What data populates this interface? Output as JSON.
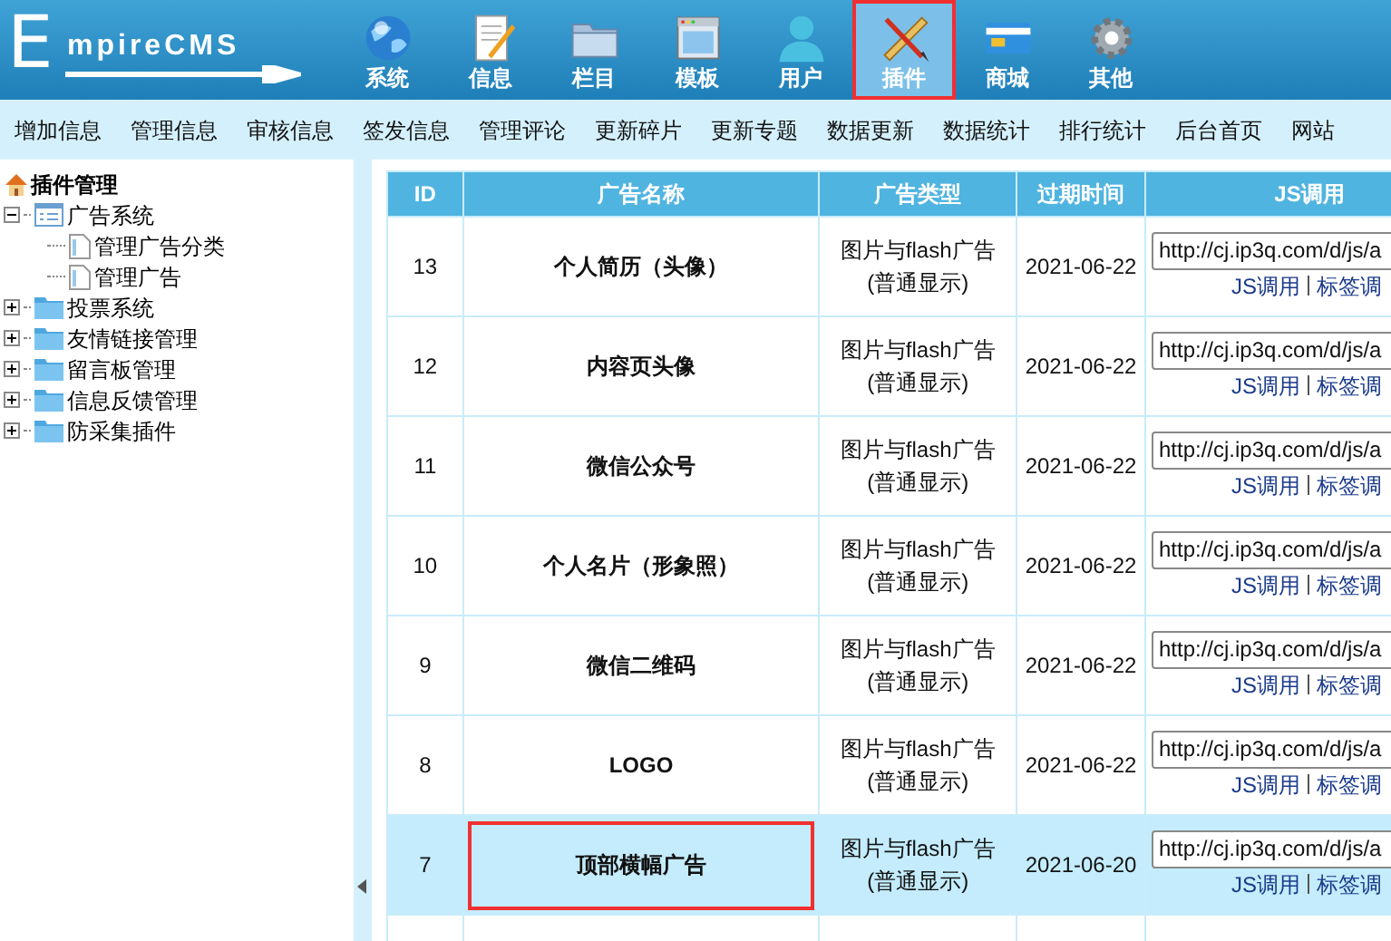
{
  "logo": {
    "text": "mpireCMS",
    "initial": "E"
  },
  "nav": [
    {
      "label": "系统",
      "selected": false,
      "outlined": false
    },
    {
      "label": "信息",
      "selected": false,
      "outlined": false
    },
    {
      "label": "栏目",
      "selected": false,
      "outlined": false
    },
    {
      "label": "模板",
      "selected": false,
      "outlined": false
    },
    {
      "label": "用户",
      "selected": false,
      "outlined": false
    },
    {
      "label": "插件",
      "selected": true,
      "outlined": true
    },
    {
      "label": "商城",
      "selected": false,
      "outlined": false
    },
    {
      "label": "其他",
      "selected": false,
      "outlined": false
    }
  ],
  "menu": [
    "增加信息",
    "管理信息",
    "审核信息",
    "签发信息",
    "管理评论",
    "更新碎片",
    "更新专题",
    "数据更新",
    "数据统计",
    "排行统计",
    "后台首页",
    "网站"
  ],
  "sidebar": {
    "title": "插件管理",
    "items": [
      {
        "label": "广告系统",
        "expanded": true,
        "children": [
          {
            "label": "管理广告分类"
          },
          {
            "label": "管理广告"
          }
        ]
      },
      {
        "label": "投票系统",
        "expanded": false
      },
      {
        "label": "友情链接管理",
        "expanded": false
      },
      {
        "label": "留言板管理",
        "expanded": false
      },
      {
        "label": "信息反馈管理",
        "expanded": false
      },
      {
        "label": "防采集插件",
        "expanded": false
      }
    ]
  },
  "table": {
    "columns": [
      "ID",
      "广告名称",
      "广告类型",
      "过期时间",
      "JS调用"
    ],
    "rows": [
      {
        "id": "13",
        "name": "个人简历（头像）",
        "type": "图片与flash广告",
        "mode": "(普通显示)",
        "expires": "2021-06-22",
        "js": "http://cj.ip3q.com/d/js/a",
        "links": [
          "JS调用",
          "标签调"
        ],
        "selected": false,
        "outlined": false
      },
      {
        "id": "12",
        "name": "内容页头像",
        "type": "图片与flash广告",
        "mode": "(普通显示)",
        "expires": "2021-06-22",
        "js": "http://cj.ip3q.com/d/js/a",
        "links": [
          "JS调用",
          "标签调"
        ],
        "selected": false,
        "outlined": false
      },
      {
        "id": "11",
        "name": "微信公众号",
        "type": "图片与flash广告",
        "mode": "(普通显示)",
        "expires": "2021-06-22",
        "js": "http://cj.ip3q.com/d/js/a",
        "links": [
          "JS调用",
          "标签调"
        ],
        "selected": false,
        "outlined": false
      },
      {
        "id": "10",
        "name": "个人名片（形象照）",
        "type": "图片与flash广告",
        "mode": "(普通显示)",
        "expires": "2021-06-22",
        "js": "http://cj.ip3q.com/d/js/a",
        "links": [
          "JS调用",
          "标签调"
        ],
        "selected": false,
        "outlined": false
      },
      {
        "id": "9",
        "name": "微信二维码",
        "type": "图片与flash广告",
        "mode": "(普通显示)",
        "expires": "2021-06-22",
        "js": "http://cj.ip3q.com/d/js/a",
        "links": [
          "JS调用",
          "标签调"
        ],
        "selected": false,
        "outlined": false
      },
      {
        "id": "8",
        "name": "LOGO",
        "type": "图片与flash广告",
        "mode": "(普通显示)",
        "expires": "2021-06-22",
        "js": "http://cj.ip3q.com/d/js/a",
        "links": [
          "JS调用",
          "标签调"
        ],
        "selected": false,
        "outlined": false
      },
      {
        "id": "7",
        "name": "顶部横幅广告",
        "type": "图片与flash广告",
        "mode": "(普通显示)",
        "expires": "2021-06-20",
        "js": "http://cj.ip3q.com/d/js/a",
        "links": [
          "JS调用",
          "标签调"
        ],
        "selected": true,
        "outlined": true
      }
    ]
  }
}
